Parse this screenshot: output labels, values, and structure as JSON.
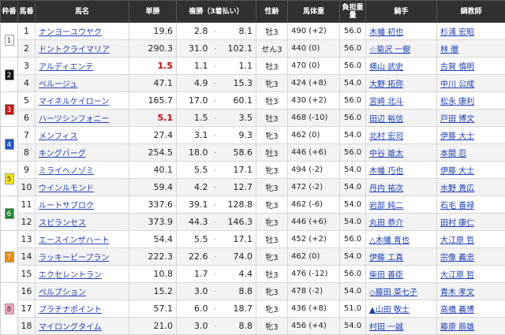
{
  "headers": {
    "waku": "枠番",
    "uma": "馬番",
    "name": "馬名",
    "tansho": "単勝",
    "fukusho": "複勝（3着払い）",
    "sex": "性齢",
    "weight": "馬体重",
    "burden": "負担重量",
    "jockey": "騎手",
    "trainer": "調教師"
  },
  "waku_colors": {
    "1": {
      "bg": "#ffffff",
      "fg": "#333333"
    },
    "2": {
      "bg": "#111111",
      "fg": "#ffffff"
    },
    "3": {
      "bg": "#cc1111",
      "fg": "#ffffff"
    },
    "4": {
      "bg": "#1e56c8",
      "fg": "#ffffff"
    },
    "5": {
      "bg": "#ffe600",
      "fg": "#333333"
    },
    "6": {
      "bg": "#1e8a30",
      "fg": "#ffffff"
    },
    "7": {
      "bg": "#f08a00",
      "fg": "#ffffff"
    },
    "8": {
      "bg": "#f5a3c0",
      "fg": "#333333"
    }
  },
  "waku_groups": [
    {
      "waku": "1",
      "rows": 2
    },
    {
      "waku": "2",
      "rows": 2
    },
    {
      "waku": "3",
      "rows": 2
    },
    {
      "waku": "4",
      "rows": 2
    },
    {
      "waku": "5",
      "rows": 2
    },
    {
      "waku": "6",
      "rows": 2
    },
    {
      "waku": "7",
      "rows": 3
    },
    {
      "waku": "8",
      "rows": 3
    }
  ],
  "rows": [
    {
      "num": "1",
      "name": "ナンヨーユウヤク",
      "odds": "19.6",
      "hot": false,
      "fmin": "2.8",
      "fmax": "8.1",
      "sex": "牡3",
      "weight": "490 (+2)",
      "burden": "56.0",
      "jockey": "木幡 初也",
      "trainer": "杉浦 宏昭"
    },
    {
      "num": "2",
      "name": "ドントクライマリア",
      "odds": "290.3",
      "hot": false,
      "fmin": "31.0",
      "fmax": "102.1",
      "sex": "せん3",
      "weight": "440 (0)",
      "burden": "56.0",
      "jockey": "☆菊沢 一樹",
      "trainer": "林 徹"
    },
    {
      "num": "3",
      "name": "アルディエンテ",
      "odds": "1.5",
      "hot": true,
      "fmin": "1.1",
      "fmax": "1.1",
      "sex": "牡3",
      "weight": "470 (0)",
      "burden": "56.0",
      "jockey": "横山 武史",
      "trainer": "古賀 慎明"
    },
    {
      "num": "4",
      "name": "ベルージュ",
      "odds": "47.1",
      "hot": false,
      "fmin": "4.9",
      "fmax": "15.3",
      "sex": "牝3",
      "weight": "424 (+8)",
      "burden": "54.0",
      "jockey": "大野 拓弥",
      "trainer": "中川 公成"
    },
    {
      "num": "5",
      "name": "マイネルケイローン",
      "odds": "165.7",
      "hot": false,
      "fmin": "17.0",
      "fmax": "60.1",
      "sex": "牡3",
      "weight": "430 (+2)",
      "burden": "56.0",
      "jockey": "宮崎 北斗",
      "trainer": "松永 康利"
    },
    {
      "num": "6",
      "name": "ハーツシンフォニー",
      "odds": "5.1",
      "hot": true,
      "fmin": "1.5",
      "fmax": "3.5",
      "sex": "牡3",
      "weight": "468 (-10)",
      "burden": "56.0",
      "jockey": "田辺 裕信",
      "trainer": "戸田 博文"
    },
    {
      "num": "7",
      "name": "メンフィス",
      "odds": "27.4",
      "hot": false,
      "fmin": "3.1",
      "fmax": "9.3",
      "sex": "牝3",
      "weight": "462 (0)",
      "burden": "54.0",
      "jockey": "北村 宏司",
      "trainer": "伊藤 大士"
    },
    {
      "num": "8",
      "name": "キングバーグ",
      "odds": "254.5",
      "hot": false,
      "fmin": "18.0",
      "fmax": "58.6",
      "sex": "牡3",
      "weight": "446 (+6)",
      "burden": "56.0",
      "jockey": "中谷 雄太",
      "trainer": "本間 忍"
    },
    {
      "num": "9",
      "name": "ミライヘノゾミ",
      "odds": "40.1",
      "hot": false,
      "fmin": "5.5",
      "fmax": "17.1",
      "sex": "牝3",
      "weight": "494 (-2)",
      "burden": "54.0",
      "jockey": "木幡 巧也",
      "trainer": "伊藤 大士"
    },
    {
      "num": "10",
      "name": "ウインルモンド",
      "odds": "59.4",
      "hot": false,
      "fmin": "4.2",
      "fmax": "12.7",
      "sex": "牝3",
      "weight": "472 (-2)",
      "burden": "54.0",
      "jockey": "丹内 祐次",
      "trainer": "水野 貴広"
    },
    {
      "num": "11",
      "name": "ルートサブロク",
      "odds": "337.6",
      "hot": false,
      "fmin": "39.1",
      "fmax": "128.8",
      "sex": "牝3",
      "weight": "462 (-6)",
      "burden": "54.0",
      "jockey": "岩部 純二",
      "trainer": "石毛 善禄"
    },
    {
      "num": "12",
      "name": "スピランセス",
      "odds": "373.9",
      "hot": false,
      "fmin": "44.3",
      "fmax": "146.3",
      "sex": "牝3",
      "weight": "446 (+6)",
      "burden": "54.0",
      "jockey": "丸田 恭介",
      "trainer": "田村 康仁"
    },
    {
      "num": "13",
      "name": "エースインザハート",
      "odds": "54.4",
      "hot": false,
      "fmin": "5.5",
      "fmax": "17.1",
      "sex": "牡3",
      "weight": "452 (+2)",
      "burden": "56.0",
      "jockey": "△木幡 育也",
      "trainer": "大江原 哲"
    },
    {
      "num": "14",
      "name": "ラッキービープラン",
      "odds": "222.3",
      "hot": false,
      "fmin": "22.6",
      "fmax": "74.0",
      "sex": "牝3",
      "weight": "462 (0)",
      "burden": "54.0",
      "jockey": "伊藤 工真",
      "trainer": "宗像 義忠"
    },
    {
      "num": "15",
      "name": "エクセレントラン",
      "odds": "10.8",
      "hot": false,
      "fmin": "1.7",
      "fmax": "4.4",
      "sex": "牡3",
      "weight": "476 (-12)",
      "burden": "56.0",
      "jockey": "柴田 善臣",
      "trainer": "大江原 哲"
    },
    {
      "num": "16",
      "name": "ペルブション",
      "odds": "15.2",
      "hot": false,
      "fmin": "3.0",
      "fmax": "8.8",
      "sex": "牝3",
      "weight": "478 (-2)",
      "burden": "54.0",
      "jockey": "◇藤田 菜七子",
      "trainer": "青木 孝文"
    },
    {
      "num": "17",
      "name": "プラチナポイント",
      "odds": "57.1",
      "hot": false,
      "fmin": "6.0",
      "fmax": "18.7",
      "sex": "牝3",
      "weight": "436 (+8)",
      "burden": "51.0",
      "jockey": "▲山田 敬士",
      "trainer": "高橋 義博"
    },
    {
      "num": "18",
      "name": "マイロングタイム",
      "odds": "21.0",
      "hot": false,
      "fmin": "3.0",
      "fmax": "8.8",
      "sex": "牝3",
      "weight": "456 (+4)",
      "burden": "54.0",
      "jockey": "村田 一誠",
      "trainer": "藤原 辰雄"
    }
  ]
}
